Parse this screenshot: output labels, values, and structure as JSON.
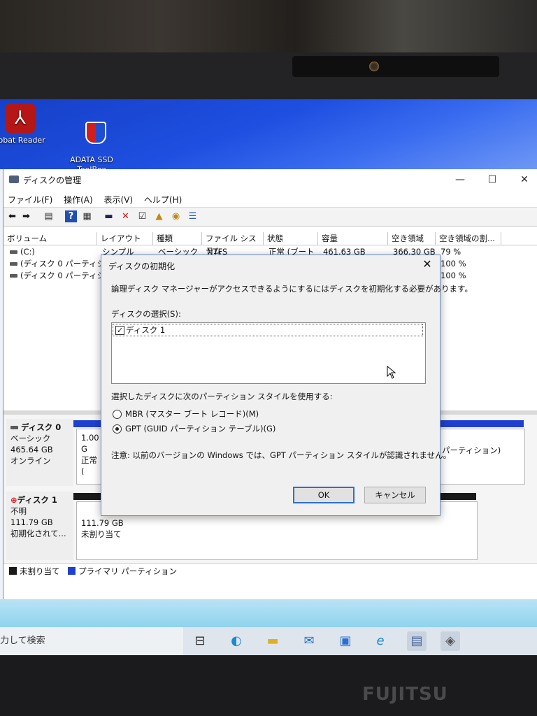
{
  "desktop": {
    "icons": [
      {
        "label": "robat Reader",
        "icon": "acrobat-icon"
      },
      {
        "label": "ADATA SSD\nToolBox",
        "icon": "adata-shield-icon"
      }
    ]
  },
  "window": {
    "title": "ディスクの管理",
    "controls": {
      "minimize": "—",
      "maximize": "☐",
      "close": "✕"
    },
    "menu": [
      "ファイル(F)",
      "操作(A)",
      "表示(V)",
      "ヘルプ(H)"
    ],
    "volume_columns": [
      "ボリューム",
      "レイアウト",
      "種類",
      "ファイル システム",
      "状態",
      "容量",
      "空き領域",
      "空き領域の割..."
    ],
    "volumes": [
      {
        "name": "(C:)",
        "layout": "シンプル",
        "type": "ベーシック",
        "fs": "NTFS",
        "status": "正常 (ブート",
        "capacity": "461.63 GB",
        "free": "366.30 GB",
        "pct": "79 %"
      },
      {
        "name": "(ディスク 0 パーティシ...",
        "pct": "100 %"
      },
      {
        "name": "(ディスク 0 パーティシ...",
        "pct": "100 %"
      }
    ],
    "disks": [
      {
        "name": "ディスク 0",
        "type": "ベーシック",
        "size": "465.64 GB",
        "state": "オンライン",
        "part_size": "1.00 G",
        "part_status": "正常 (",
        "part_right": "パーティション)"
      },
      {
        "name": "ディスク 1",
        "type": "不明",
        "size": "111.79 GB",
        "state": "初期化されて...",
        "part_size": "111.79 GB",
        "part_status": "未割り当て"
      }
    ],
    "legend": [
      {
        "label": "未割り当て",
        "color": "#1a1a1a"
      },
      {
        "label": "プライマリ パーティション",
        "color": "#1f3fd0"
      }
    ]
  },
  "dialog": {
    "title": "ディスクの初期化",
    "intro": "論理ディスク マネージャーがアクセスできるようにするにはディスクを初期化する必要があります。",
    "select_label": "ディスクの選択(S):",
    "disk_items": [
      {
        "label": "ディスク 1",
        "checked": true
      }
    ],
    "style_label": "選択したディスクに次のパーティション スタイルを使用する:",
    "options": [
      {
        "label": "MBR (マスター ブート レコード)(M)",
        "selected": false
      },
      {
        "label": "GPT (GUID パーティション テーブル)(G)",
        "selected": true
      }
    ],
    "note": "注意: 以前のバージョンの Windows では、GPT パーティション スタイルが認識されません。",
    "ok": "OK",
    "cancel": "キャンセル"
  },
  "taskbar": {
    "search_placeholder": "力して検索",
    "apps": [
      "task-view-icon",
      "edge-icon",
      "file-explorer-icon",
      "mail-icon",
      "photo-icon",
      "ie-icon",
      "disk-mgmt-icon",
      "adata-icon"
    ]
  },
  "hardware": {
    "brand": "FUJITSU"
  }
}
